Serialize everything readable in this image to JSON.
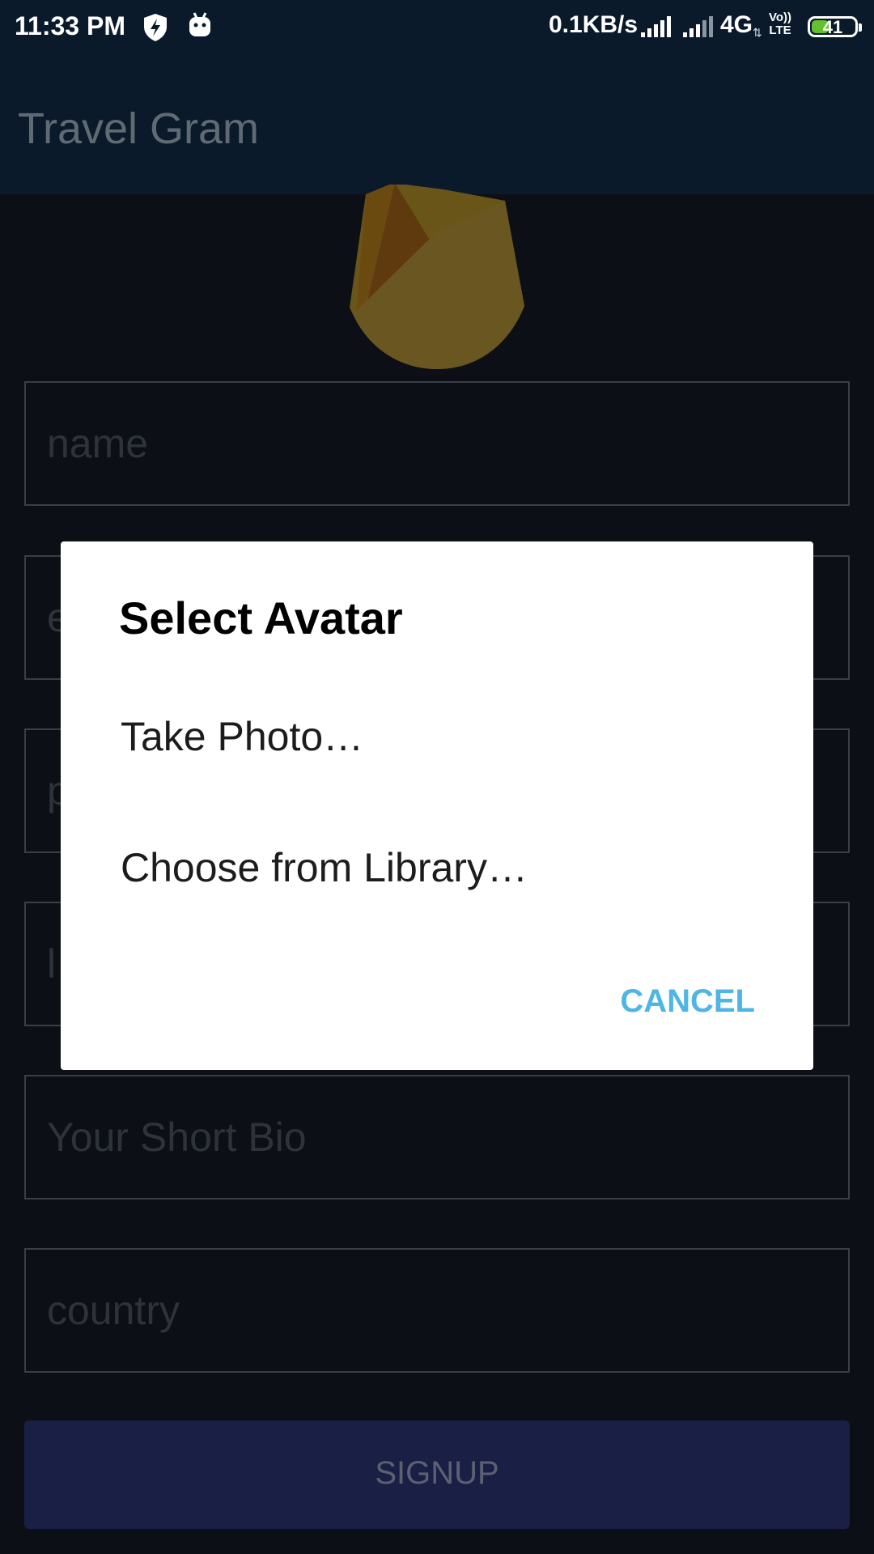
{
  "status_bar": {
    "time": "11:33 PM",
    "data_rate": "0.1KB/s",
    "network": "4G",
    "volte_top": "Vo))",
    "volte_bottom": "LTE",
    "battery": "41",
    "battery_level": 0.41,
    "icons": [
      "shield-bolt-icon",
      "android-icon",
      "signal-icon",
      "signal-icon",
      "data-arrows-icon",
      "volte-icon",
      "battery-icon"
    ]
  },
  "app_bar": {
    "title": "Travel Gram"
  },
  "form": {
    "logo_icon": "firebase-flame-icon",
    "fields": [
      {
        "placeholder": "name"
      },
      {
        "placeholder": "e"
      },
      {
        "placeholder": "p"
      },
      {
        "placeholder": "l"
      },
      {
        "placeholder": "Your Short Bio"
      },
      {
        "placeholder": "country"
      }
    ],
    "signup_label": "SIGNUP"
  },
  "dialog": {
    "title": "Select Avatar",
    "options": [
      "Take Photo…",
      "Choose from Library…"
    ],
    "cancel_label": "CANCEL"
  },
  "colors": {
    "status_bar_bg": "#0a1a2b",
    "app_bar_bg": "#0a1a2b",
    "scrim_bg": "#0c1016",
    "dialog_bg": "#ffffff",
    "accent": "#4fb6e3",
    "signup_bg": "#1a1f45",
    "battery_green": "#63c130"
  }
}
